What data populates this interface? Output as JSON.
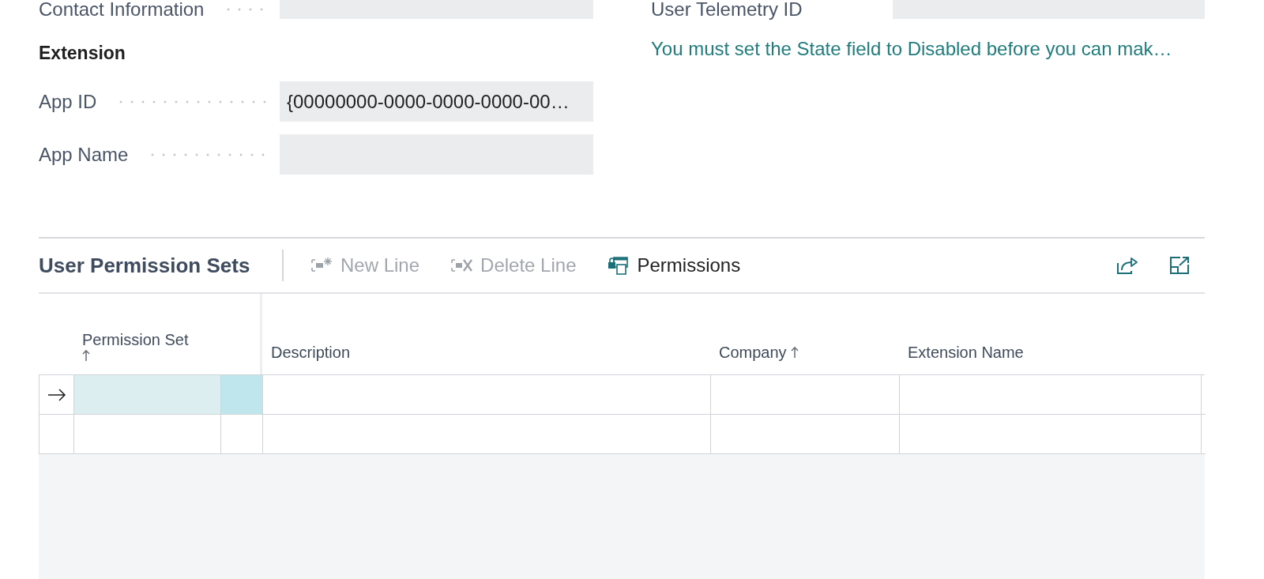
{
  "contact_field": {
    "label": "Contact Information"
  },
  "telemetry_field": {
    "label": "User Telemetry ID"
  },
  "extension": {
    "heading": "Extension",
    "fields": [
      {
        "label": "App ID",
        "value": "{00000000-0000-0000-0000-00…"
      },
      {
        "label": "App Name"
      }
    ]
  },
  "notice": "You must set the State field to Disabled before you can mak…",
  "permission_sets": {
    "title": "User Permission Sets",
    "actions": [
      {
        "kind": "new",
        "label": "New Line",
        "disabled": true
      },
      {
        "kind": "delete",
        "label": "Delete Line",
        "disabled": true
      },
      {
        "kind": "permissions",
        "label": "Permissions",
        "disabled": false
      }
    ],
    "columns": [
      {
        "label": "Permission Set",
        "sorted": true
      },
      {
        "label": "Description",
        "sorted": false
      },
      {
        "label": "Company",
        "sorted": true
      },
      {
        "label": "Extension Name",
        "sorted": false
      }
    ],
    "rows": [
      {
        "selected": true
      },
      {
        "selected": false
      }
    ]
  }
}
